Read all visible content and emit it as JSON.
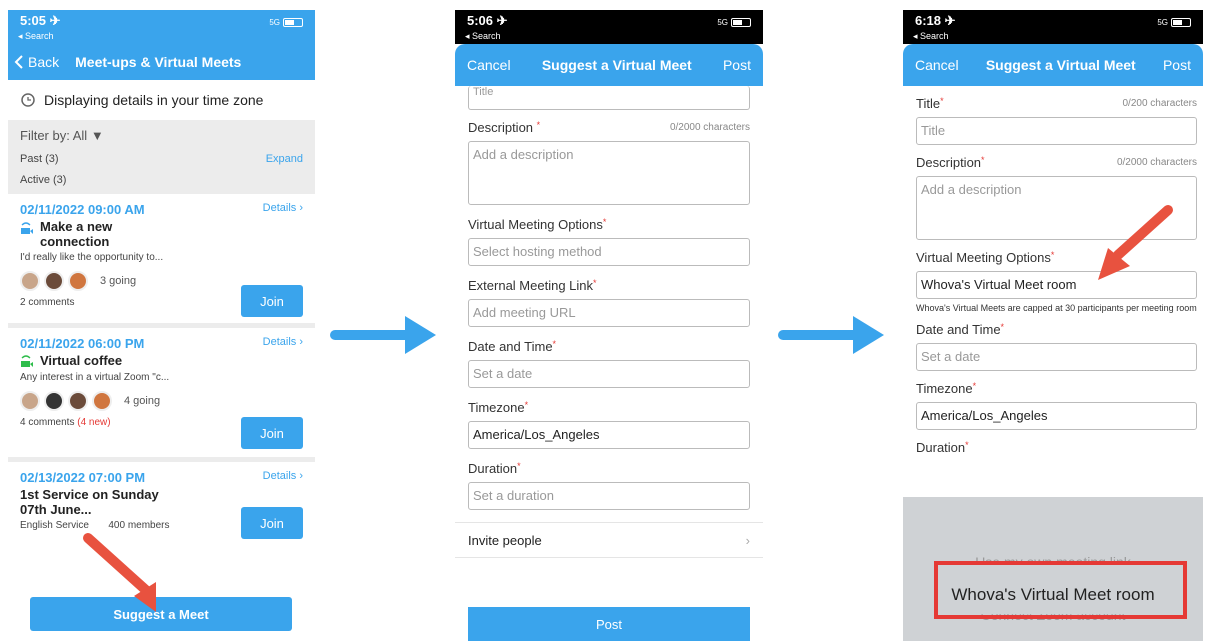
{
  "phone1": {
    "status": {
      "time": "5:05 ✈",
      "back": "◂ Search",
      "signal": "5G"
    },
    "nav": {
      "back": "Back",
      "title": "Meet-ups & Virtual Meets"
    },
    "timezone_text": "Displaying details in your time zone",
    "filter": "Filter by: All",
    "past": "Past (3)",
    "expand": "Expand",
    "active": "Active (3)",
    "cards": [
      {
        "date": "02/11/2022 09:00 AM",
        "details": "Details ›",
        "title_line1": "Make a new",
        "title_line2": "connection",
        "desc": "I'd really like the opportunity to...",
        "going": "3 going",
        "comments": "2 comments",
        "new": "",
        "join": "Join"
      },
      {
        "date": "02/11/2022 06:00 PM",
        "details": "Details ›",
        "title_line1": "Virtual coffee",
        "title_line2": "",
        "desc": "Any interest in a virtual Zoom \"c...",
        "going": "4 going",
        "comments": "4 comments",
        "new": "(4 new)",
        "join": "Join"
      },
      {
        "date": "02/13/2022 07:00 PM",
        "details": "Details ›",
        "title_line1": "1st Service on Sunday",
        "title_line2": "07th June...",
        "desc": "English Service",
        "members": "400 members",
        "join": "Join"
      }
    ],
    "suggest": "Suggest a Meet"
  },
  "phone2": {
    "status": {
      "time": "5:06 ✈",
      "back": "◂ Search",
      "signal": "5G"
    },
    "nav": {
      "cancel": "Cancel",
      "title": "Suggest a Virtual Meet",
      "post": "Post"
    },
    "title_partial": "Title",
    "description_label": "Description",
    "description_counter": "0/2000 characters",
    "description_placeholder": "Add a description",
    "vmo_label": "Virtual Meeting Options",
    "vmo_placeholder": "Select hosting method",
    "eml_label": "External Meeting Link",
    "eml_placeholder": "Add meeting URL",
    "dt_label": "Date and Time",
    "dt_placeholder": "Set a date",
    "tz_label": "Timezone",
    "tz_value": "America/Los_Angeles",
    "dur_label": "Duration",
    "dur_placeholder": "Set a duration",
    "invite": "Invite people",
    "post_button": "Post"
  },
  "phone3": {
    "status": {
      "time": "6:18 ✈",
      "back": "◂ Search",
      "signal": "5G"
    },
    "nav": {
      "cancel": "Cancel",
      "title": "Suggest a Virtual Meet",
      "post": "Post"
    },
    "title_label": "Title",
    "title_counter": "0/200 characters",
    "title_placeholder": "Title",
    "description_label": "Description",
    "description_counter": "0/2000 characters",
    "description_placeholder": "Add a description",
    "vmo_label": "Virtual Meeting Options",
    "vmo_value": "Whova's Virtual Meet room",
    "vmo_note": "Whova's Virtual Meets are capped at 30 participants per meeting room",
    "dt_label": "Date and Time",
    "dt_placeholder": "Set a date",
    "tz_label": "Timezone",
    "tz_value": "America/Los_Angeles",
    "dur_label": "Duration",
    "picker_above": "Use my own meeting link",
    "picker_selected": "Whova's Virtual Meet room",
    "picker_below": "Connect Zoom account"
  },
  "colors": {
    "accent": "#3aa4ec",
    "required": "#e53935",
    "annotation_arrow": "#e8523f"
  }
}
